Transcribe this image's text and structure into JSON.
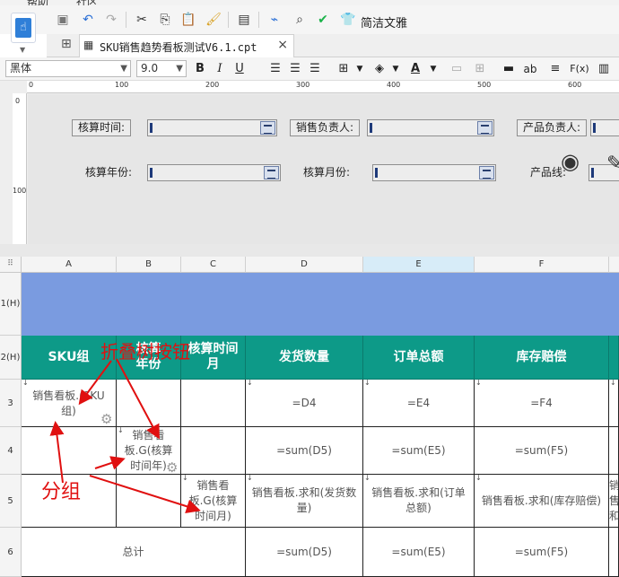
{
  "menu": {
    "items": [
      "帮助",
      "社区"
    ]
  },
  "toolbar": {
    "style_label": "简洁文雅"
  },
  "tab": {
    "file_name": "SKU销售趋势看板测试V6.1.cpt",
    "close": "×"
  },
  "format": {
    "font_family": "黑体",
    "font_size": "9.0",
    "bold": "B",
    "italic": "I",
    "underline": "U",
    "text_label": "ab",
    "fx": "F(x)"
  },
  "ruler": {
    "top": [
      "0",
      "100",
      "200",
      "300",
      "400",
      "500",
      "600"
    ],
    "left": [
      "0",
      "100"
    ]
  },
  "params": [
    {
      "label": "核算时间:"
    },
    {
      "label": "销售负责人:"
    },
    {
      "label": "产品负责人:"
    },
    {
      "label": "核算年份:"
    },
    {
      "label": "核算月份:"
    },
    {
      "label": "产品线:"
    }
  ],
  "grid": {
    "columns": [
      "A",
      "B",
      "C",
      "D",
      "E",
      "F"
    ],
    "rows": [
      "1(H)",
      "2(H)",
      "3",
      "4",
      "5",
      "6"
    ],
    "header": {
      "a": "SKU组",
      "b": "核算年份",
      "c": "核算时间月",
      "d": "发货数量",
      "e": "订单总额",
      "f": "库存赔偿"
    },
    "r3": {
      "a": "销售看板.(SKU组)",
      "d": "=D4",
      "e": "=E4",
      "f": "=F4"
    },
    "r4": {
      "b": "销售看板.G(核算时间年)",
      "d": "=sum(D5)",
      "e": "=sum(E5)",
      "f": "=sum(F5)"
    },
    "r5": {
      "c": "销售看板.G(核算时间月)",
      "d": "销售看板.求和(发货数量)",
      "e": "销售看板.求和(订单总额)",
      "f": "销售看板.求和(库存赔偿)",
      "g": "销售和"
    },
    "r6": {
      "ab": "总计",
      "d": "=sum(D5)",
      "e": "=sum(E5)",
      "f": "=sum(F5)"
    }
  },
  "annotations": {
    "collapse": "折叠树按钮",
    "group": "分组"
  },
  "colors": {
    "header_bg": "#0d9a88",
    "title_bg": "#7a9be0",
    "annotation": "#e01010"
  }
}
